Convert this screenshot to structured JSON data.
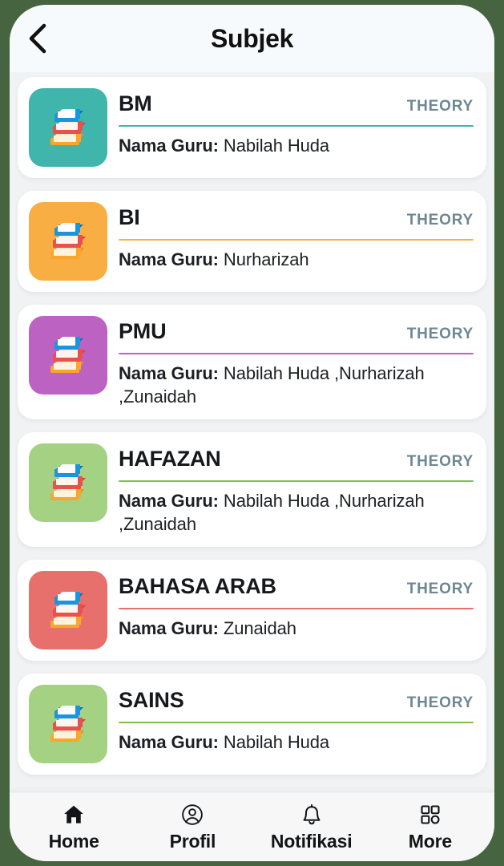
{
  "header": {
    "title": "Subjek",
    "back_icon": "chevron-left-icon"
  },
  "theme": {
    "frame_color": "#46643F",
    "screen_bg": "#F1F2F4",
    "header_bg": "#F7FAFC",
    "card_bg": "#FFFFFF",
    "title_color": "#111111",
    "type_label_color": "#6E8793",
    "nav_bg": "#F7F7F7",
    "nav_label_color": "#121417"
  },
  "subjects": [
    {
      "name": "BM",
      "type": "THEORY",
      "accent": "#3FB5AB",
      "icon": "books-stack-icon",
      "teacher_label": "Nama Guru:",
      "teacher_names": "Nabilah Huda"
    },
    {
      "name": "BI",
      "type": "THEORY",
      "accent": "#F9AE44",
      "icon": "books-stack-icon",
      "teacher_label": "Nama Guru:",
      "teacher_names": "Nurharizah"
    },
    {
      "name": "PMU",
      "type": "THEORY",
      "accent": "#BB62C2",
      "icon": "books-stack-icon",
      "teacher_label": "Nama Guru:",
      "teacher_names": "Nabilah Huda ,Nurharizah ,Zunaidah"
    },
    {
      "name": "HAFAZAN",
      "type": "THEORY",
      "accent": "#A5D183",
      "icon": "books-stack-icon",
      "teacher_label": "Nama Guru:",
      "teacher_names": "Nabilah Huda ,Nurharizah ,Zunaidah"
    },
    {
      "name": "BAHASA ARAB",
      "type": "THEORY",
      "accent": "#E8706C",
      "icon": "books-stack-icon",
      "teacher_label": "Nama Guru:",
      "teacher_names": "Zunaidah"
    },
    {
      "name": "SAINS",
      "type": "THEORY",
      "accent": "#A5D183",
      "icon": "books-stack-icon",
      "teacher_label": "Nama Guru:",
      "teacher_names": "Nabilah Huda"
    }
  ],
  "bottom_nav": {
    "items": [
      {
        "label": "Home",
        "icon": "home-icon"
      },
      {
        "label": "Profil",
        "icon": "user-circle-icon"
      },
      {
        "label": "Notifikasi",
        "icon": "bell-icon"
      },
      {
        "label": "More",
        "icon": "grid-menu-icon"
      }
    ]
  }
}
